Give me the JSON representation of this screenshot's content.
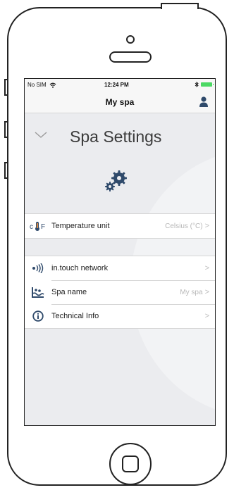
{
  "status_bar": {
    "carrier": "No SIM",
    "time": "12:24 PM"
  },
  "nav": {
    "title": "My spa"
  },
  "header": {
    "title": "Spa Settings"
  },
  "settings_sections": [
    {
      "rows": [
        {
          "icon": "temperature-unit-icon",
          "label": "Temperature unit",
          "value": "Celsius (°C)"
        }
      ]
    },
    {
      "rows": [
        {
          "icon": "network-icon",
          "label": "in.touch network",
          "value": ""
        },
        {
          "icon": "spa-name-icon",
          "label": "Spa name",
          "value": "My spa"
        },
        {
          "icon": "info-icon",
          "label": "Technical Info",
          "value": ""
        }
      ]
    }
  ],
  "colors": {
    "accent": "#2f4a6b",
    "background": "#ebecef"
  }
}
